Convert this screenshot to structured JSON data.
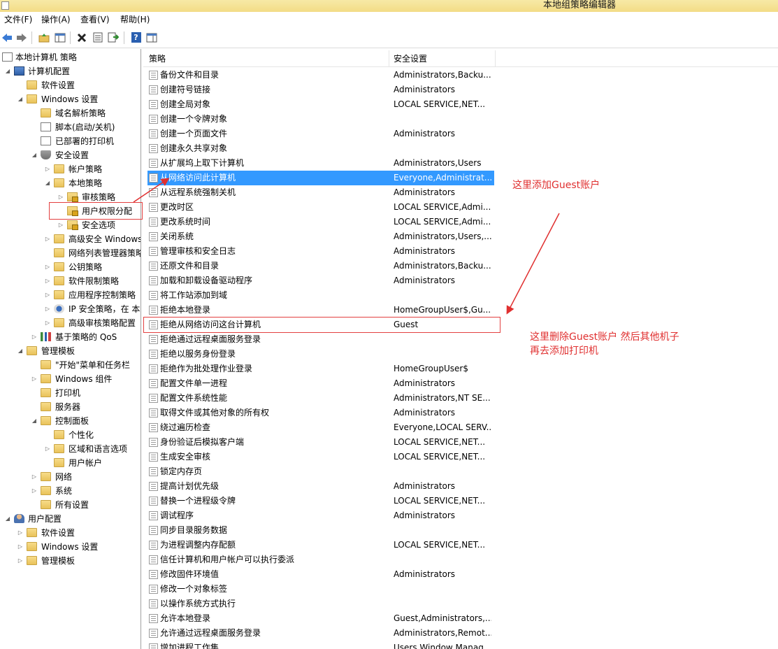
{
  "window": {
    "title": "本地组策略编辑器"
  },
  "menu": [
    "文件(F)",
    "操作(A)",
    "查看(V)",
    "帮助(H)"
  ],
  "toolbar": {
    "icons": [
      "back-arrow-icon",
      "forward-arrow-icon",
      "up-folder-icon",
      "show-hide-tree-icon",
      "delete-icon",
      "properties-icon",
      "export-list-icon",
      "help-icon",
      "show-hide-action-pane-icon"
    ],
    "help_glyph": "?"
  },
  "tree": {
    "root": "本地计算机 策略",
    "computer_config": "计算机配置",
    "software_settings": "软件设置",
    "windows_settings": "Windows 设置",
    "dns_policy": "域名解析策略",
    "scripts": "脚本(启动/关机)",
    "deployed_printers": "已部署的打印机",
    "security_settings": "安全设置",
    "account_policy": "帐户策略",
    "local_policy": "本地策略",
    "audit_policy": "审核策略",
    "user_rights": "用户权限分配",
    "security_options": "安全选项",
    "advanced_firewall": "高级安全 Windows",
    "network_list": "网络列表管理器策略",
    "public_key": "公钥策略",
    "software_restriction": "软件限制策略",
    "app_control": "应用程序控制策略",
    "ip_security": "IP 安全策略，在 本",
    "advanced_audit": "高级审核策略配置",
    "qos": "基于策略的 QoS",
    "admin_templates": "管理模板",
    "start_menu": "\"开始\"菜单和任务栏",
    "windows_components": "Windows 组件",
    "printers": "打印机",
    "servers": "服务器",
    "control_panel": "控制面板",
    "personalization": "个性化",
    "region_language": "区域和语言选项",
    "user_accounts": "用户帐户",
    "network": "网络",
    "system": "系统",
    "all_settings": "所有设置",
    "user_config": "用户配置",
    "u_software_settings": "软件设置",
    "u_windows_settings": "Windows 设置",
    "u_admin_templates": "管理模板"
  },
  "list": {
    "col_policy": "策略",
    "col_security": "安全设置",
    "rows": [
      {
        "name": "备份文件和目录",
        "value": "Administrators,Backu..."
      },
      {
        "name": "创建符号链接",
        "value": "Administrators"
      },
      {
        "name": "创建全局对象",
        "value": "LOCAL SERVICE,NET..."
      },
      {
        "name": "创建一个令牌对象",
        "value": ""
      },
      {
        "name": "创建一个页面文件",
        "value": "Administrators"
      },
      {
        "name": "创建永久共享对象",
        "value": ""
      },
      {
        "name": "从扩展坞上取下计算机",
        "value": "Administrators,Users"
      },
      {
        "name": "从网络访问此计算机",
        "value": "Everyone,Administrat..."
      },
      {
        "name": "从远程系统强制关机",
        "value": "Administrators"
      },
      {
        "name": "更改时区",
        "value": "LOCAL SERVICE,Admi..."
      },
      {
        "name": "更改系统时间",
        "value": "LOCAL SERVICE,Admi..."
      },
      {
        "name": "关闭系统",
        "value": "Administrators,Users,..."
      },
      {
        "name": "管理审核和安全日志",
        "value": "Administrators"
      },
      {
        "name": "还原文件和目录",
        "value": "Administrators,Backu..."
      },
      {
        "name": "加载和卸载设备驱动程序",
        "value": "Administrators"
      },
      {
        "name": "将工作站添加到域",
        "value": ""
      },
      {
        "name": "拒绝本地登录",
        "value": "HomeGroupUser$,Gu..."
      },
      {
        "name": "拒绝从网络访问这台计算机",
        "value": "Guest"
      },
      {
        "name": "拒绝通过远程桌面服务登录",
        "value": ""
      },
      {
        "name": "拒绝以服务身份登录",
        "value": ""
      },
      {
        "name": "拒绝作为批处理作业登录",
        "value": "HomeGroupUser$"
      },
      {
        "name": "配置文件单一进程",
        "value": "Administrators"
      },
      {
        "name": "配置文件系统性能",
        "value": "Administrators,NT SE..."
      },
      {
        "name": "取得文件或其他对象的所有权",
        "value": "Administrators"
      },
      {
        "name": "绕过遍历检查",
        "value": "Everyone,LOCAL SERV..."
      },
      {
        "name": "身份验证后模拟客户端",
        "value": "LOCAL SERVICE,NET..."
      },
      {
        "name": "生成安全审核",
        "value": "LOCAL SERVICE,NET..."
      },
      {
        "name": "锁定内存页",
        "value": ""
      },
      {
        "name": "提高计划优先级",
        "value": "Administrators"
      },
      {
        "name": "替换一个进程级令牌",
        "value": "LOCAL SERVICE,NET..."
      },
      {
        "name": "调试程序",
        "value": "Administrators"
      },
      {
        "name": "同步目录服务数据",
        "value": ""
      },
      {
        "name": "为进程调整内存配额",
        "value": "LOCAL SERVICE,NET..."
      },
      {
        "name": "信任计算机和用户帐户可以执行委派",
        "value": ""
      },
      {
        "name": "修改固件环境值",
        "value": "Administrators"
      },
      {
        "name": "修改一个对象标签",
        "value": ""
      },
      {
        "name": "以操作系统方式执行",
        "value": ""
      },
      {
        "name": "允许本地登录",
        "value": "Guest,Administrators,..."
      },
      {
        "name": "允许通过远程桌面服务登录",
        "value": "Administrators,Remot..."
      },
      {
        "name": "增加进程工作集",
        "value": "Users,Window Manag..."
      }
    ],
    "selected_index": 7
  },
  "annotations": {
    "add_guest": "这里添加Guest账户",
    "delete_guest_line1": "这里删除Guest账户 然后其他机子",
    "delete_guest_line2": "再去添加打印机"
  },
  "colors": {
    "selection": "#3399ff",
    "annotation": "#e03030",
    "titlebar": "#f3dc86"
  }
}
